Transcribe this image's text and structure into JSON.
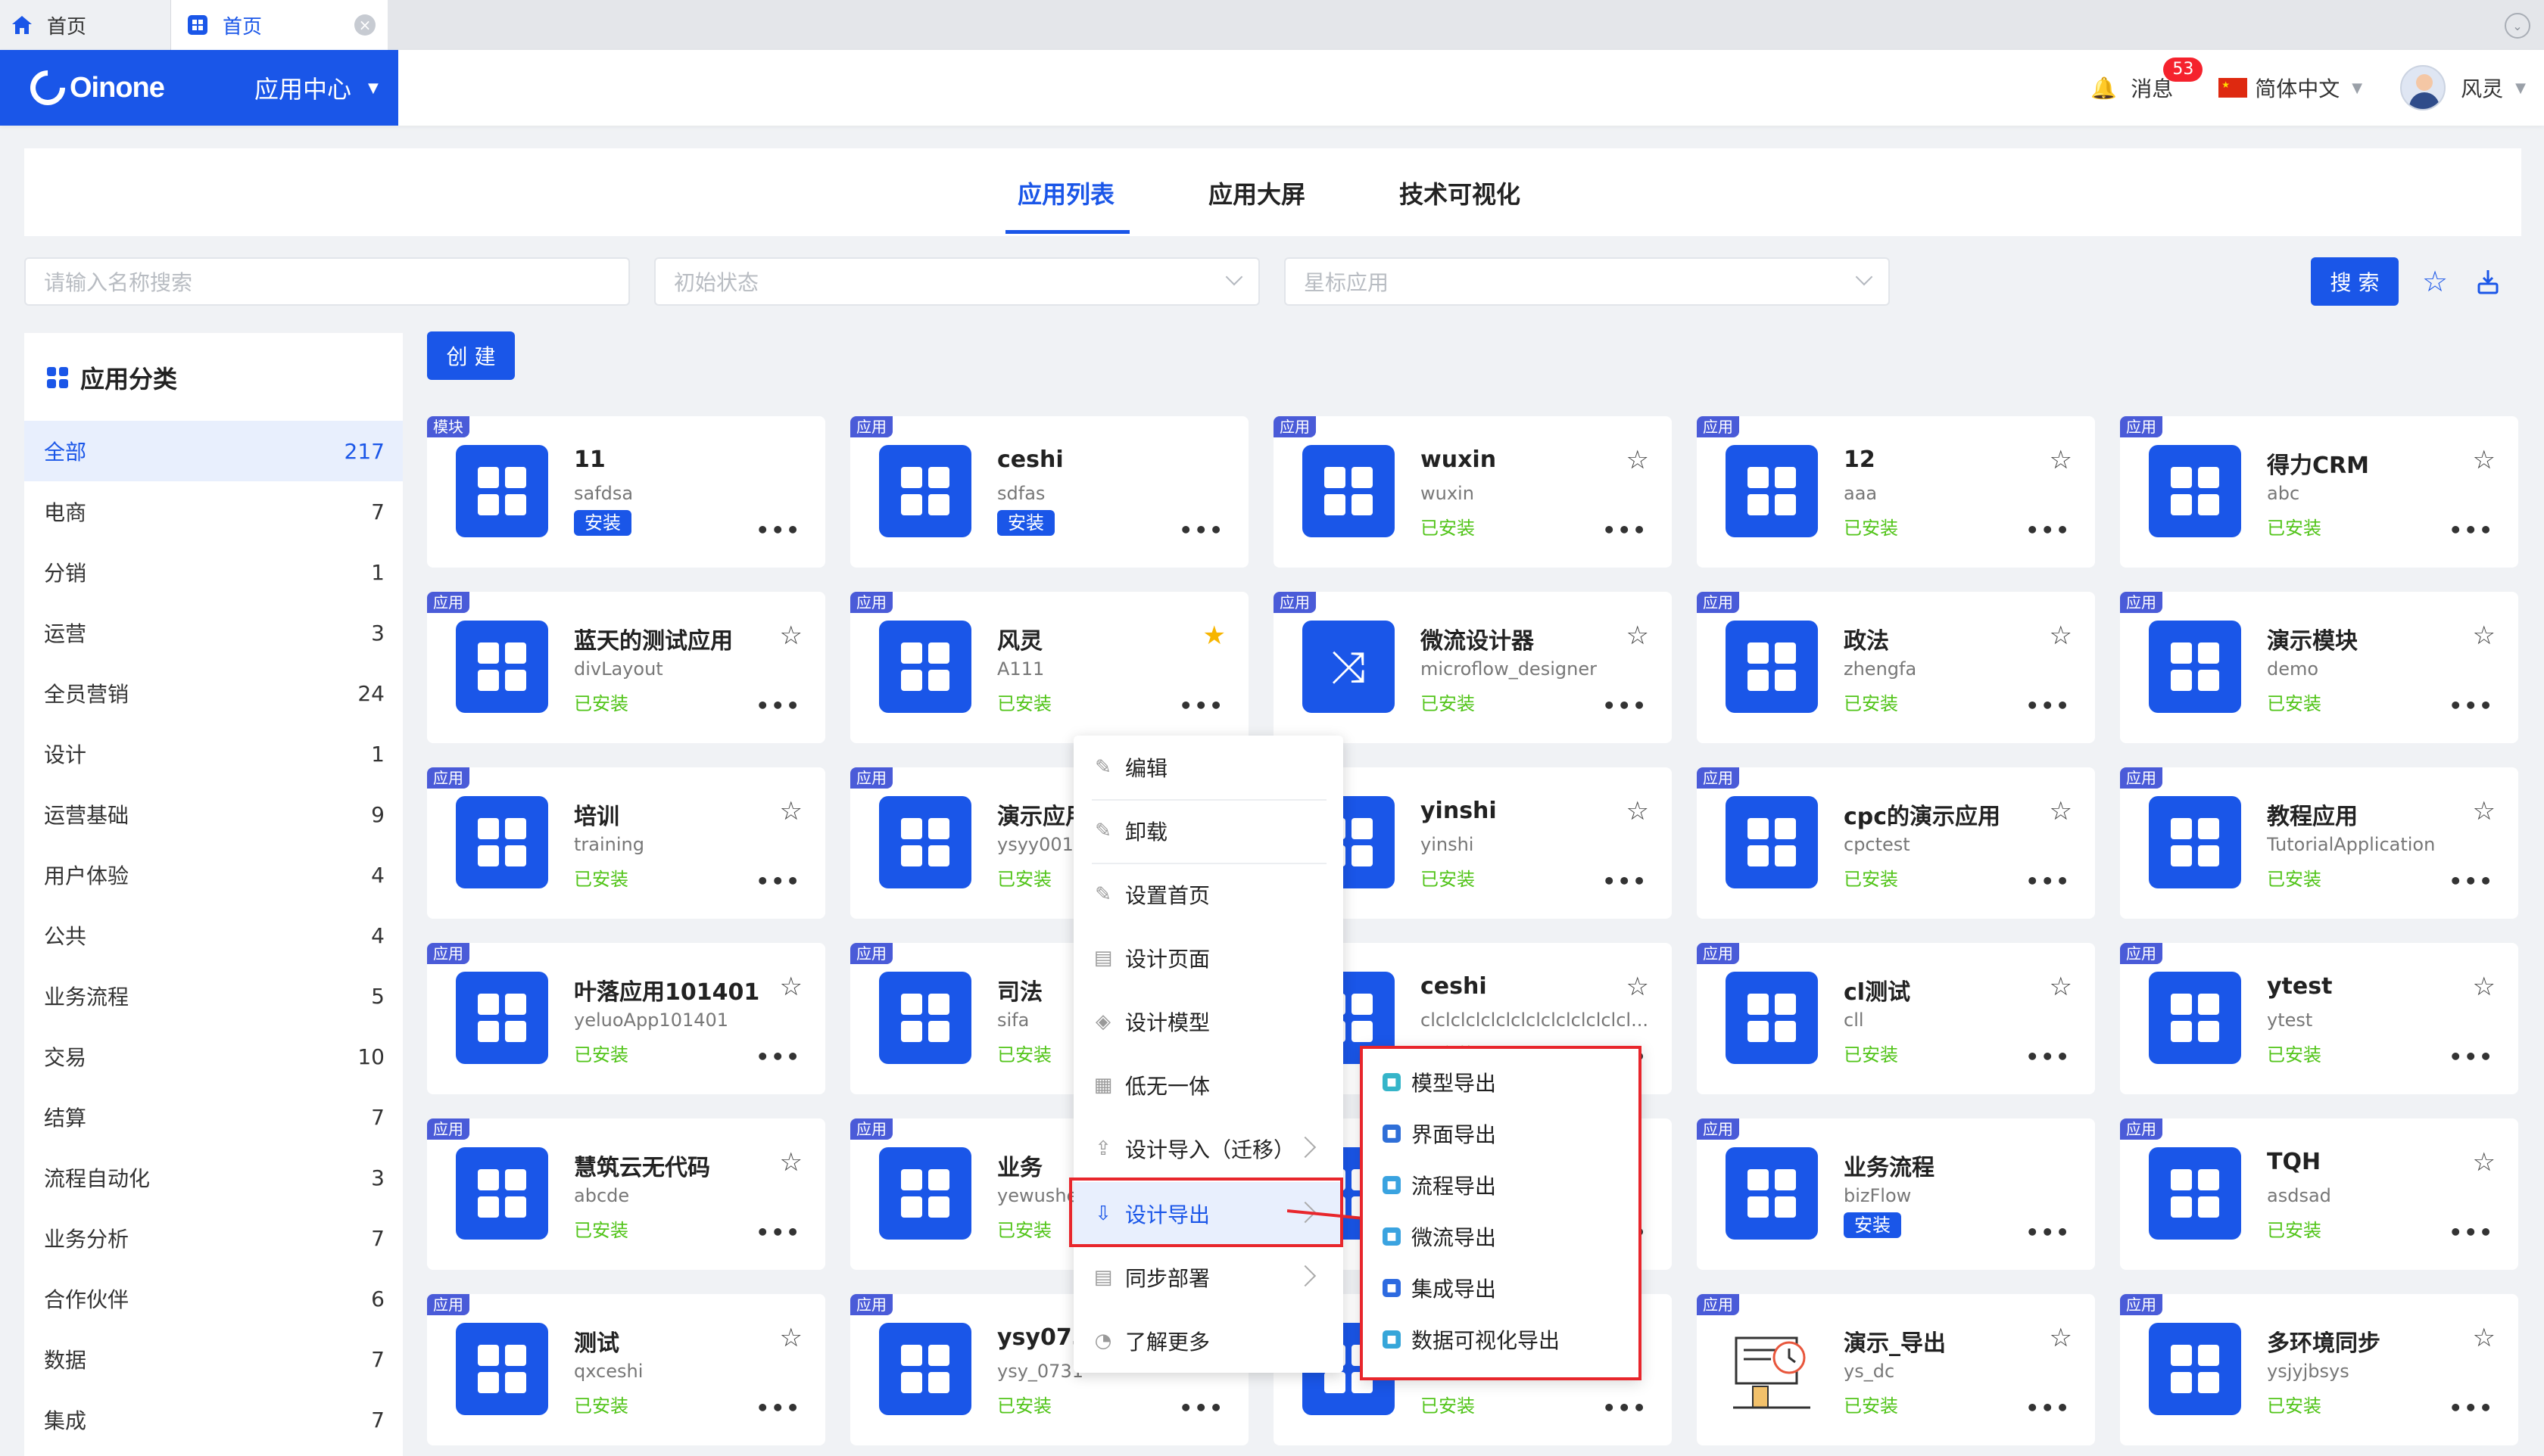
{
  "browser_tabs": [
    {
      "label": "首页",
      "active": false
    },
    {
      "label": "首页",
      "active": true
    }
  ],
  "header": {
    "brand": "Oinone",
    "app_center": "应用中心",
    "messages_label": "消息",
    "messages_count": "53",
    "language": "简体中文",
    "user": "风灵"
  },
  "main_tabs": [
    "应用列表",
    "应用大屏",
    "技术可视化"
  ],
  "filters": {
    "name_placeholder": "请输入名称搜索",
    "status_placeholder": "初始状态",
    "star_placeholder": "星标应用",
    "search_label": "搜 索"
  },
  "create_label": "创 建",
  "sidebar": {
    "title": "应用分类",
    "items": [
      {
        "label": "全部",
        "count": "217"
      },
      {
        "label": "电商",
        "count": "7"
      },
      {
        "label": "分销",
        "count": "1"
      },
      {
        "label": "运营",
        "count": "3"
      },
      {
        "label": "全员营销",
        "count": "24"
      },
      {
        "label": "设计",
        "count": "1"
      },
      {
        "label": "运营基础",
        "count": "9"
      },
      {
        "label": "用户体验",
        "count": "4"
      },
      {
        "label": "公共",
        "count": "4"
      },
      {
        "label": "业务流程",
        "count": "5"
      },
      {
        "label": "交易",
        "count": "10"
      },
      {
        "label": "结算",
        "count": "7"
      },
      {
        "label": "流程自动化",
        "count": "3"
      },
      {
        "label": "业务分析",
        "count": "7"
      },
      {
        "label": "合作伙伴",
        "count": "6"
      },
      {
        "label": "数据",
        "count": "7"
      },
      {
        "label": "集成",
        "count": "7"
      }
    ]
  },
  "cards": [
    {
      "tag": "模块",
      "name": "11",
      "code": "safdsa",
      "status": "安装",
      "install": true,
      "star": false,
      "showStar": false,
      "icon": "app"
    },
    {
      "tag": "应用",
      "name": "ceshi",
      "code": "sdfas",
      "status": "安装",
      "install": true,
      "star": false,
      "showStar": false,
      "icon": "app"
    },
    {
      "tag": "应用",
      "name": "wuxin",
      "code": "wuxin",
      "status": "已安装",
      "install": false,
      "star": false,
      "showStar": true,
      "icon": "app"
    },
    {
      "tag": "应用",
      "name": "12",
      "code": "aaa",
      "status": "已安装",
      "install": false,
      "star": false,
      "showStar": true,
      "icon": "app"
    },
    {
      "tag": "应用",
      "name": "得力CRM",
      "code": "abc",
      "status": "已安装",
      "install": false,
      "star": false,
      "showStar": true,
      "icon": "app"
    },
    {
      "tag": "应用",
      "name": "蓝天的测试应用",
      "code": "divLayout",
      "status": "已安装",
      "install": false,
      "star": false,
      "showStar": true,
      "icon": "app"
    },
    {
      "tag": "应用",
      "name": "风灵",
      "code": "A111",
      "status": "已安装",
      "install": false,
      "star": true,
      "showStar": true,
      "icon": "app"
    },
    {
      "tag": "应用",
      "name": "微流设计器",
      "code": "microflow_designer",
      "status": "已安装",
      "install": false,
      "star": false,
      "showStar": true,
      "icon": "flow"
    },
    {
      "tag": "应用",
      "name": "政法",
      "code": "zhengfa",
      "status": "已安装",
      "install": false,
      "star": false,
      "showStar": true,
      "icon": "app"
    },
    {
      "tag": "应用",
      "name": "演示模块",
      "code": "demo",
      "status": "已安装",
      "install": false,
      "star": false,
      "showStar": true,
      "icon": "app"
    },
    {
      "tag": "应用",
      "name": "培训",
      "code": "training",
      "status": "已安装",
      "install": false,
      "star": false,
      "showStar": true,
      "icon": "app"
    },
    {
      "tag": "应用",
      "name": "演示应用",
      "code": "ysyy001",
      "status": "已安装",
      "install": false,
      "star": false,
      "showStar": false,
      "icon": "app"
    },
    {
      "tag": "应用",
      "name": "yinshi",
      "code": "yinshi",
      "status": "已安装",
      "install": false,
      "star": false,
      "showStar": true,
      "icon": "app"
    },
    {
      "tag": "应用",
      "name": "cpc的演示应用",
      "code": "cpctest",
      "status": "已安装",
      "install": false,
      "star": false,
      "showStar": true,
      "icon": "app"
    },
    {
      "tag": "应用",
      "name": "教程应用",
      "code": "TutorialApplication",
      "status": "已安装",
      "install": false,
      "star": false,
      "showStar": true,
      "icon": "app"
    },
    {
      "tag": "应用",
      "name": "叶落应用101401",
      "code": "yeluoApp101401",
      "status": "已安装",
      "install": false,
      "star": false,
      "showStar": true,
      "icon": "app"
    },
    {
      "tag": "应用",
      "name": "司法",
      "code": "sifa",
      "status": "已安装",
      "install": false,
      "star": false,
      "showStar": false,
      "icon": "app"
    },
    {
      "tag": "应用",
      "name": "ceshi",
      "code": "clclclclclclclclclclclclclcl...",
      "status": "已安装",
      "install": false,
      "star": false,
      "showStar": true,
      "icon": "app"
    },
    {
      "tag": "应用",
      "name": "cl测试",
      "code": "cll",
      "status": "已安装",
      "install": false,
      "star": false,
      "showStar": true,
      "icon": "app"
    },
    {
      "tag": "应用",
      "name": "ytest",
      "code": "ytest",
      "status": "已安装",
      "install": false,
      "star": false,
      "showStar": true,
      "icon": "app"
    },
    {
      "tag": "应用",
      "name": "慧筑云无代码",
      "code": "abcde",
      "status": "已安装",
      "install": false,
      "star": false,
      "showStar": true,
      "icon": "app"
    },
    {
      "tag": "应用",
      "name": "业务",
      "code": "yewushe",
      "status": "已安装",
      "install": false,
      "star": false,
      "showStar": false,
      "icon": "app"
    },
    {
      "tag": "应用",
      "name": "",
      "code": "",
      "status": "",
      "install": false,
      "star": false,
      "showStar": false,
      "icon": "app"
    },
    {
      "tag": "应用",
      "name": "业务流程",
      "code": "bizFlow",
      "status": "安装",
      "install": true,
      "star": false,
      "showStar": false,
      "icon": "app"
    },
    {
      "tag": "应用",
      "name": "TQH",
      "code": "asdsad",
      "status": "已安装",
      "install": false,
      "star": false,
      "showStar": true,
      "icon": "app"
    },
    {
      "tag": "应用",
      "name": "测试",
      "code": "qxceshi",
      "status": "已安装",
      "install": false,
      "star": false,
      "showStar": true,
      "icon": "app"
    },
    {
      "tag": "应用",
      "name": "ysy0731",
      "code": "ysy_0731",
      "status": "已安装",
      "install": false,
      "star": false,
      "showStar": false,
      "icon": "app"
    },
    {
      "tag": "应用",
      "name": "",
      "code": "",
      "status": "已安装",
      "install": false,
      "star": false,
      "showStar": false,
      "icon": "app"
    },
    {
      "tag": "应用",
      "name": "演示_导出",
      "code": "ys_dc",
      "status": "已安装",
      "install": false,
      "star": false,
      "showStar": true,
      "icon": "illus"
    },
    {
      "tag": "应用",
      "name": "多环境同步",
      "code": "ysjyjbsys",
      "status": "已安装",
      "install": false,
      "star": false,
      "showStar": true,
      "icon": "app"
    }
  ],
  "context_menu": {
    "items": [
      {
        "label": "编辑",
        "icon": "brush-icon",
        "submenu": false
      },
      {
        "label": "卸载",
        "icon": "brush-icon",
        "submenu": false
      },
      {
        "label": "设置首页",
        "icon": "brush-icon",
        "submenu": false
      },
      {
        "label": "设计页面",
        "icon": "page-icon",
        "submenu": false
      },
      {
        "label": "设计模型",
        "icon": "cube-icon",
        "submenu": false
      },
      {
        "label": "低无一体",
        "icon": "grid-icon",
        "submenu": false
      },
      {
        "label": "设计导入（迁移）",
        "icon": "upload-icon",
        "submenu": true
      },
      {
        "label": "设计导出",
        "icon": "download-icon",
        "submenu": true,
        "highlight": true
      },
      {
        "label": "同步部署",
        "icon": "server-icon",
        "submenu": true
      },
      {
        "label": "了解更多",
        "icon": "more-icon",
        "submenu": false
      }
    ]
  },
  "export_submenu": [
    {
      "label": "模型导出",
      "color": "#36b5c9"
    },
    {
      "label": "界面导出",
      "color": "#2f6fd8"
    },
    {
      "label": "流程导出",
      "color": "#3aa3e0"
    },
    {
      "label": "微流导出",
      "color": "#3aa3e0"
    },
    {
      "label": "集成导出",
      "color": "#2d6ae0"
    },
    {
      "label": "数据可视化导出",
      "color": "#36a6d9"
    }
  ]
}
